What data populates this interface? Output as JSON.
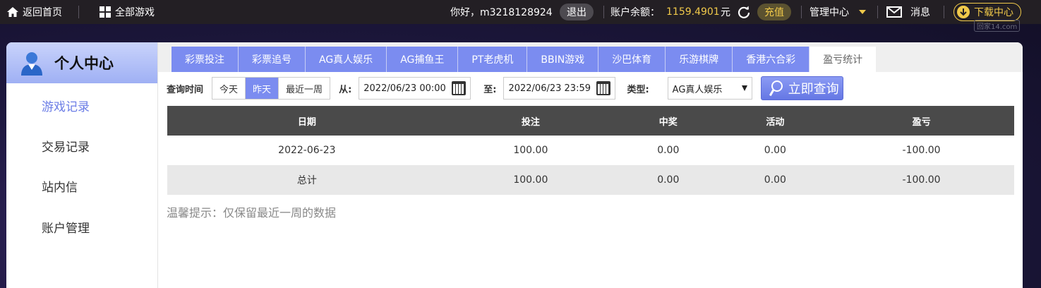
{
  "topbar": {
    "home_label": "返回首页",
    "all_games_label": "全部游戏",
    "greeting": "你好，m3218128924",
    "logout_label": "退出",
    "balance_label": "账户余额：",
    "balance_value": "1159.4901",
    "balance_unit": "元",
    "recharge_label": "充值",
    "manage_label": "管理中心",
    "message_label": "消息",
    "download_label": "下载中心",
    "watermark": "回家14.com",
    "accent_color": "#f0c94a"
  },
  "sidebar": {
    "title": "个人中心",
    "items": [
      {
        "label": "游戏记录",
        "active": true
      },
      {
        "label": "交易记录",
        "active": false
      },
      {
        "label": "站内信",
        "active": false
      },
      {
        "label": "账户管理",
        "active": false
      }
    ]
  },
  "tabs": [
    {
      "label": "彩票投注"
    },
    {
      "label": "彩票追号"
    },
    {
      "label": "AG真人娱乐"
    },
    {
      "label": "AG捕鱼王"
    },
    {
      "label": "PT老虎机"
    },
    {
      "label": "BBIN游戏"
    },
    {
      "label": "沙巴体育"
    },
    {
      "label": "乐游棋牌"
    },
    {
      "label": "香港六合彩"
    },
    {
      "label": "盈亏统计"
    }
  ],
  "filter": {
    "time_label": "查询时间",
    "ranges": [
      "今天",
      "昨天",
      "最近一周"
    ],
    "selected_range": "昨天",
    "from_label": "从:",
    "from_value": "2022/06/23 00:00",
    "to_label": "至:",
    "to_value": "2022/06/23 23:59",
    "type_label": "类型:",
    "type_value": "AG真人娱乐",
    "query_label": "立即查询"
  },
  "table": {
    "headers": [
      "日期",
      "投注",
      "中奖",
      "活动",
      "盈亏"
    ],
    "rows": [
      [
        "2022-06-23",
        "100.00",
        "0.00",
        "0.00",
        "-100.00"
      ]
    ],
    "total": [
      "总计",
      "100.00",
      "0.00",
      "0.00",
      "-100.00"
    ]
  },
  "tip": "温馨提示：仅保留最近一周的数据"
}
